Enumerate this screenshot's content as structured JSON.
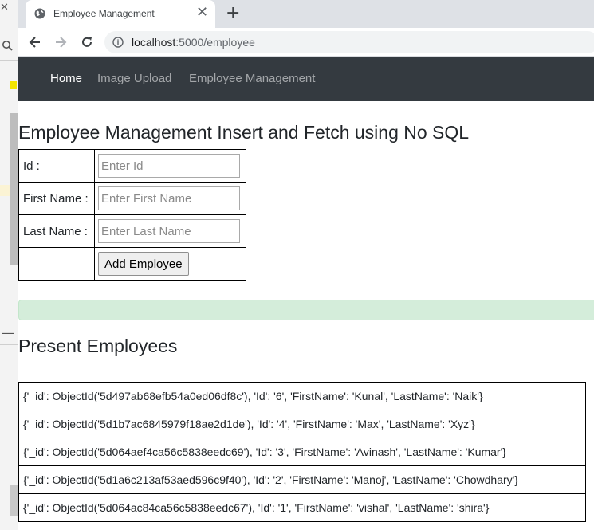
{
  "browser": {
    "tab_title": "Employee Management",
    "url_host": "localhost",
    "url_path": ":5000/employee"
  },
  "navbar": {
    "items": [
      {
        "label": "Home",
        "active": true
      },
      {
        "label": "Image Upload",
        "active": false
      },
      {
        "label": "Employee Management",
        "active": false
      }
    ]
  },
  "page": {
    "title": "Employee Management Insert and Fetch using No SQL",
    "form": {
      "id_label": "Id :",
      "id_placeholder": "Enter Id",
      "first_name_label": "First Name :",
      "first_name_placeholder": "Enter First Name",
      "last_name_label": "Last Name :",
      "last_name_placeholder": "Enter Last Name",
      "submit_label": "Add Employee"
    },
    "section_title": "Present Employees",
    "employees": [
      "{'_id': ObjectId('5d497ab68efb54a0ed06df8c'), 'Id': '6', 'FirstName': 'Kunal', 'LastName': 'Naik'}",
      "{'_id': ObjectId('5d1b7ac6845979f18ae2d1de'), 'Id': '4', 'FirstName': 'Max', 'LastName': 'Xyz'}",
      "{'_id': ObjectId('5d064aef4ca56c5838eedc69'), 'Id': '3', 'FirstName': 'Avinash', 'LastName': 'Kumar'}",
      "{'_id': ObjectId('5d1a6c213af53aed596c9f40'), 'Id': '2', 'FirstName': 'Manoj', 'LastName': 'Chowdhary'}",
      "{'_id': ObjectId('5d064ac84ca56c5838eedc67'), 'Id': '1', 'FirstName': 'vishal', 'LastName': 'shira'}"
    ]
  },
  "colors": {
    "navbar_bg": "#343a40",
    "alert_bg": "#d4edda"
  }
}
